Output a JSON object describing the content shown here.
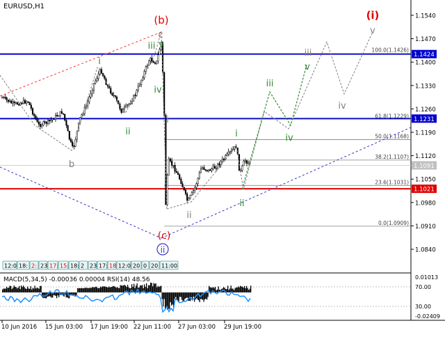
{
  "window": {
    "symbol_title": "EURUSD,H1"
  },
  "colors": {
    "background": "#ffffff",
    "candle": "#000000",
    "level_blue": "#0000cc",
    "level_red": "#e00000",
    "wave_gray": "#808080",
    "wave_green": "#2e8b2e",
    "wave_red": "#e00000",
    "dotted_red": "#ff3030",
    "dotted_blue": "#3333cc",
    "macd_line": "#1e90ff",
    "price_tag_blue": "#0000cc",
    "price_tag_red": "#e00000",
    "price_tag_gray": "#c0c0c0"
  },
  "price_axis": {
    "ticks": [
      "1.1540",
      "1.1470",
      "1.1400",
      "1.1330",
      "1.1260",
      "1.1190",
      "1.1120",
      "1.1050",
      "1.0980",
      "1.0910",
      "1.0840"
    ]
  },
  "time_axis": {
    "labels": [
      "10 Jun 2016",
      "15 Jun 03:00",
      "17 Jun 19:00",
      "22 Jun 11:00",
      "27 Jun 03:00",
      "29 Jun 19:00"
    ]
  },
  "levels": {
    "blue_upper": {
      "price": 1.1424,
      "label": "1.1424"
    },
    "blue_lower": {
      "price": 1.1231,
      "label": "1.1231"
    },
    "red_support": {
      "price": 1.1021,
      "label": "1.1021"
    },
    "current_price": {
      "price": 1.1091,
      "label": "1.1091"
    }
  },
  "fibonacci": {
    "levels": [
      {
        "price": 1.1426,
        "label": "100.0(1.1426)"
      },
      {
        "price": 1.1229,
        "label": "61.8(1.1229)"
      },
      {
        "price": 1.1168,
        "label": "50.0(1.1168)"
      },
      {
        "price": 1.1107,
        "label": "38.2(1.1107)"
      },
      {
        "price": 1.1031,
        "label": "23.6(1.1031)"
      },
      {
        "price": 1.0909,
        "label": "0.0(1.0909)"
      }
    ]
  },
  "wave_labels": {
    "b_red": "(b)",
    "c_red": "(c)",
    "i_red_top": "(i)",
    "ii_blue_circle": "ii",
    "gray": [
      "c",
      "b",
      "i",
      "ii",
      "iii",
      "iv",
      "v"
    ],
    "green": [
      "i",
      "ii",
      "iii",
      "iv",
      "v"
    ]
  },
  "toolbar": {
    "items": [
      "12:0",
      "18:",
      "2:",
      "23",
      "17:",
      "15:",
      "18:",
      "2",
      "23",
      "17:",
      "18",
      "12:0",
      "20",
      "0",
      "20",
      "11:00"
    ]
  },
  "indicator": {
    "title": "MACD(5,34,5) -0.00036 0.00004 RSI(14) 48.56",
    "right_ticks": [
      "0.01013",
      "70.00",
      "30.00",
      "-0.02409"
    ]
  }
}
